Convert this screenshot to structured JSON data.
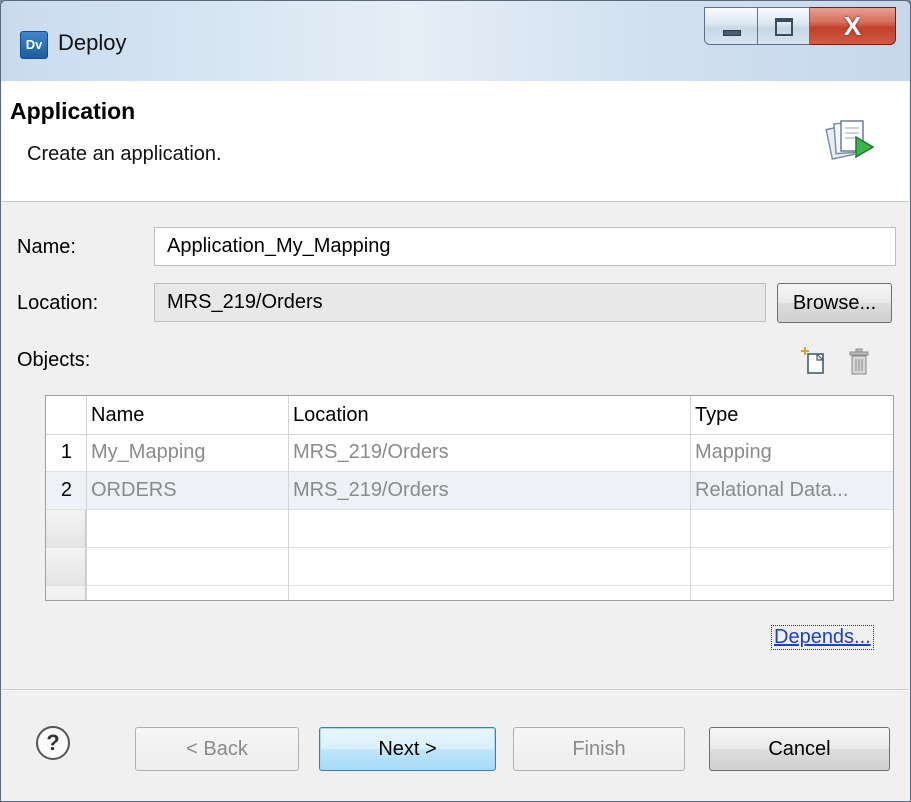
{
  "window": {
    "logo_text": "Dv",
    "title": "Deploy",
    "close_glyph": "X"
  },
  "header": {
    "title": "Application",
    "description": "Create an application."
  },
  "form": {
    "name_label": "Name:",
    "name_value": "Application_My_Mapping",
    "location_label": "Location:",
    "location_value": "MRS_219/Orders",
    "browse_label": "Browse...",
    "objects_label": "Objects:"
  },
  "table": {
    "headers": [
      "Name",
      "Location",
      "Type"
    ],
    "rows": [
      {
        "num": "1",
        "name": "My_Mapping",
        "location": "MRS_219/Orders",
        "type": "Mapping"
      },
      {
        "num": "2",
        "name": "ORDERS",
        "location": "MRS_219/Orders",
        "type": "Relational  Data..."
      }
    ]
  },
  "links": {
    "depends": "Depends..."
  },
  "footer": {
    "help": "?",
    "back": "< Back",
    "next": "Next >",
    "finish": "Finish",
    "cancel": "Cancel"
  }
}
